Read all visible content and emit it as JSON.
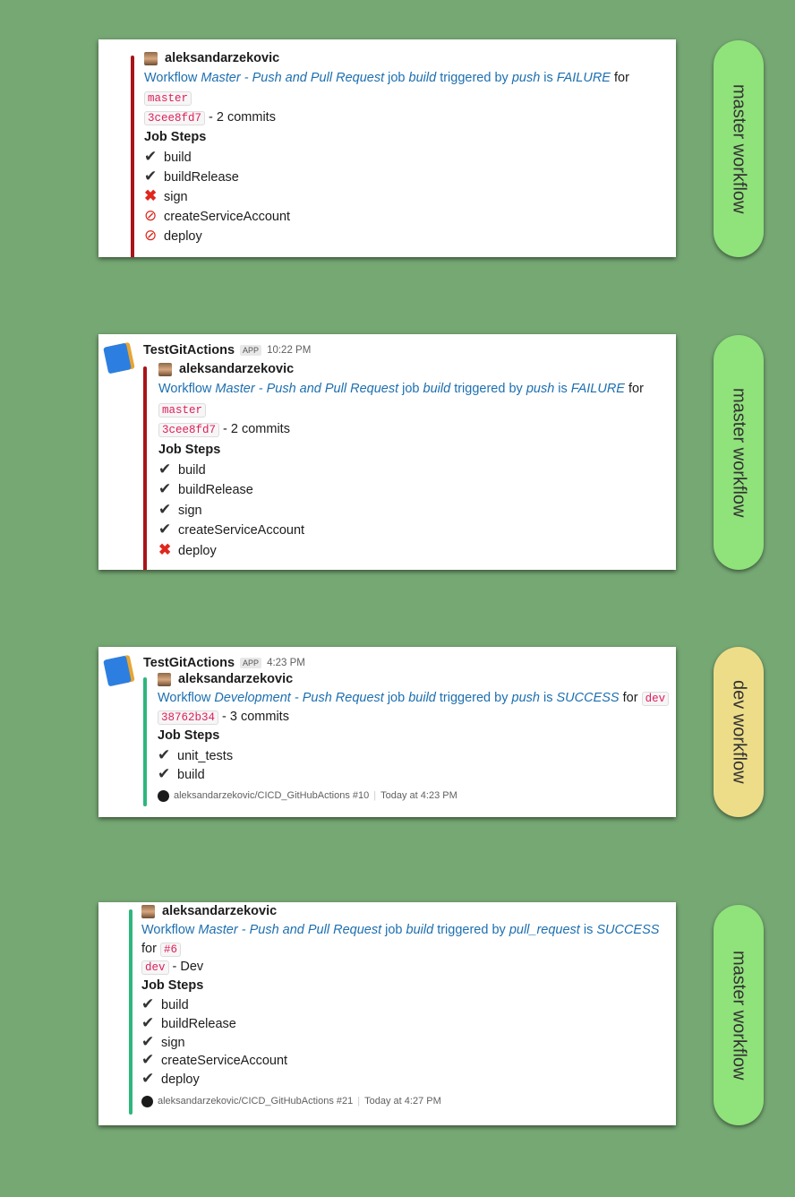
{
  "colors": {
    "background": "#76a874",
    "failure_bar": "#a8141a",
    "success_bar": "#2eb67d",
    "master_pill": "#90e27b",
    "dev_pill": "#eedd88",
    "link": "#1d6fb0"
  },
  "cards": [
    {
      "status": "failure",
      "app": null,
      "user": "aleksandarzekovic",
      "message": {
        "prefix": "Workflow ",
        "workflow": "Master - Push and Pull Request",
        "mid1": " job ",
        "job": "build",
        "mid2": " triggered by ",
        "trigger": "push",
        "mid3": " is ",
        "result": "FAILURE",
        "suffix": " for"
      },
      "ref": "master",
      "ref_inline": false,
      "commit": "3cee8fd7",
      "commit_text": " - 2 commits",
      "steps_title": "Job Steps",
      "steps": [
        {
          "icon": "check-icon",
          "label": "build"
        },
        {
          "icon": "check-icon",
          "label": "buildRelease"
        },
        {
          "icon": "cross-icon",
          "label": "sign"
        },
        {
          "icon": "no-entry-icon",
          "label": "createServiceAccount"
        },
        {
          "icon": "no-entry-icon",
          "label": "deploy"
        }
      ],
      "footer": null,
      "pill": "master workflow"
    },
    {
      "status": "failure",
      "app": {
        "name": "TestGitActions",
        "badge": "APP",
        "time": "10:22 PM"
      },
      "user": "aleksandarzekovic",
      "message": {
        "prefix": "Workflow ",
        "workflow": "Master - Push and Pull Request",
        "mid1": " job ",
        "job": "build",
        "mid2": " triggered by ",
        "trigger": "push",
        "mid3": " is ",
        "result": "FAILURE",
        "suffix": " for"
      },
      "ref": "master",
      "ref_inline": false,
      "commit": "3cee8fd7",
      "commit_text": " - 2 commits",
      "steps_title": "Job Steps",
      "steps": [
        {
          "icon": "check-icon",
          "label": "build"
        },
        {
          "icon": "check-icon",
          "label": "buildRelease"
        },
        {
          "icon": "check-icon",
          "label": "sign"
        },
        {
          "icon": "check-icon",
          "label": "createServiceAccount"
        },
        {
          "icon": "cross-icon",
          "label": "deploy"
        }
      ],
      "footer": null,
      "pill": "master workflow"
    },
    {
      "status": "success",
      "app": {
        "name": "TestGitActions",
        "badge": "APP",
        "time": "4:23 PM"
      },
      "user": "aleksandarzekovic",
      "message": {
        "prefix": "Workflow ",
        "workflow": "Development - Push Request",
        "mid1": " job ",
        "job": "build",
        "mid2": " triggered by ",
        "trigger": "push",
        "mid3": " is ",
        "result": "SUCCESS",
        "suffix": " for "
      },
      "ref": "dev",
      "ref_inline": true,
      "commit": "38762b34",
      "commit_text": " - 3 commits",
      "steps_title": "Job Steps",
      "steps": [
        {
          "icon": "check-icon",
          "label": "unit_tests"
        },
        {
          "icon": "check-icon",
          "label": "build"
        }
      ],
      "footer": {
        "repo": "aleksandarzekovic/CICD_GitHubActions #10",
        "time": "Today at 4:23 PM"
      },
      "pill": "dev workflow"
    },
    {
      "status": "success",
      "app": null,
      "user": "aleksandarzekovic",
      "message": {
        "prefix": "Workflow ",
        "workflow": "Master - Push and Pull Request",
        "mid1": " job ",
        "job": "build",
        "mid2": " triggered by ",
        "trigger": "pull_request",
        "mid3": " is ",
        "result": "SUCCESS",
        "suffix": ""
      },
      "for_line": {
        "text": "for ",
        "pr": "#6"
      },
      "ref": "dev",
      "ref_inline": false,
      "commit": null,
      "ref_text": " - Dev",
      "steps_title": "Job Steps",
      "steps": [
        {
          "icon": "check-icon",
          "label": "build"
        },
        {
          "icon": "check-icon",
          "label": "buildRelease"
        },
        {
          "icon": "check-icon",
          "label": "sign"
        },
        {
          "icon": "check-icon",
          "label": "createServiceAccount"
        },
        {
          "icon": "check-icon",
          "label": "deploy"
        }
      ],
      "footer": {
        "repo": "aleksandarzekovic/CICD_GitHubActions #21",
        "time": "Today at 4:27 PM"
      },
      "pill": "master workflow"
    }
  ]
}
